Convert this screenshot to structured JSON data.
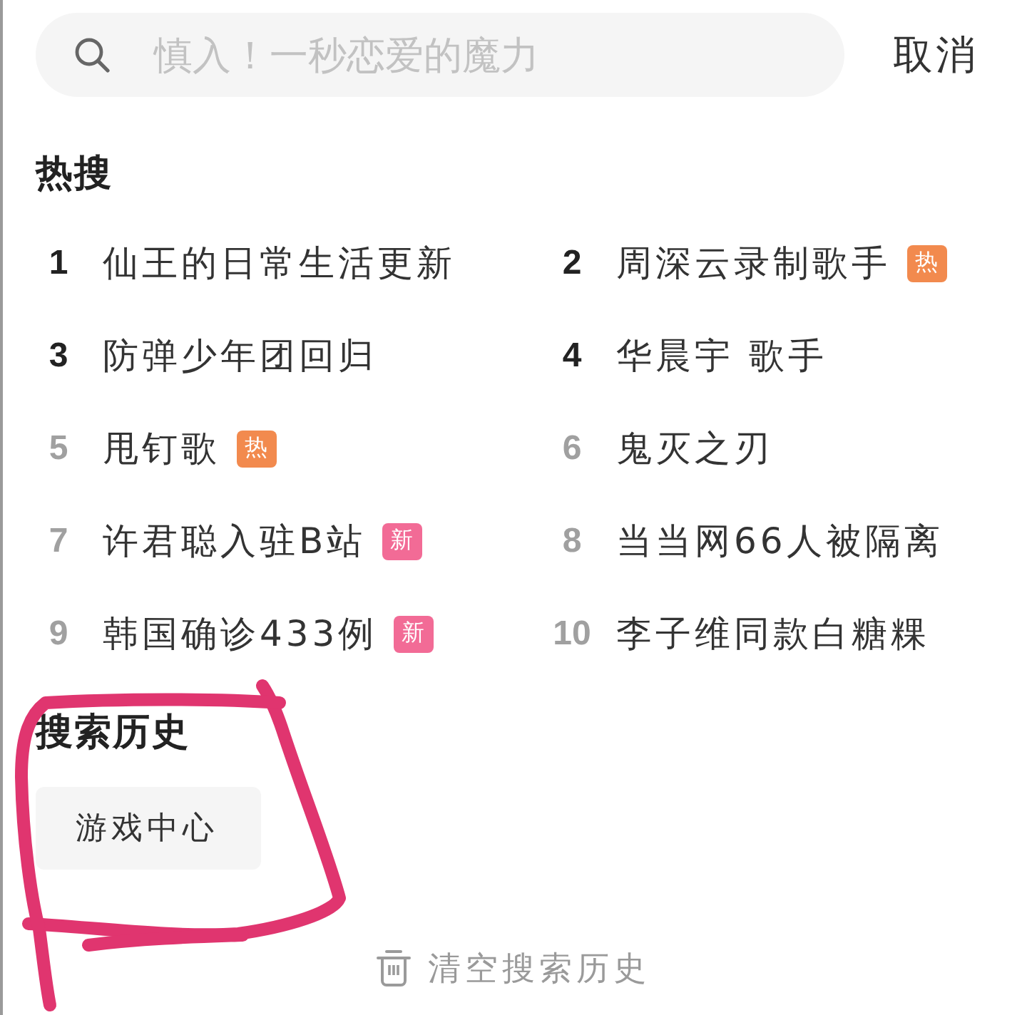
{
  "search": {
    "placeholder": "慎入！一秒恋爱的魔力"
  },
  "cancel_button": "取消",
  "hot_search": {
    "title": "热搜",
    "items": [
      {
        "rank": "1",
        "title": "仙王的日常生活更新",
        "emphasized": true
      },
      {
        "rank": "2",
        "title": "周深云录制歌手",
        "emphasized": true,
        "badge": {
          "text": "热",
          "color": "#f28a4e"
        }
      },
      {
        "rank": "3",
        "title": "防弹少年团回归",
        "emphasized": true
      },
      {
        "rank": "4",
        "title": "华晨宇 歌手",
        "emphasized": true
      },
      {
        "rank": "5",
        "title": "甩钉歌",
        "emphasized": false,
        "badge": {
          "text": "热",
          "color": "#f28a4e"
        }
      },
      {
        "rank": "6",
        "title": "鬼灭之刃",
        "emphasized": false
      },
      {
        "rank": "7",
        "title": "许君聪入驻B站",
        "emphasized": false,
        "badge": {
          "text": "新",
          "color": "#f26b96"
        }
      },
      {
        "rank": "8",
        "title": "当当网66人被隔离",
        "emphasized": false
      },
      {
        "rank": "9",
        "title": "韩国确诊433例",
        "emphasized": false,
        "badge": {
          "text": "新",
          "color": "#f26b96"
        }
      },
      {
        "rank": "10",
        "title": "李子维同款白糖粿",
        "emphasized": false
      }
    ]
  },
  "history": {
    "title": "搜索历史",
    "items": [
      "游戏中心"
    ],
    "clear_button": "清空搜索历史"
  }
}
